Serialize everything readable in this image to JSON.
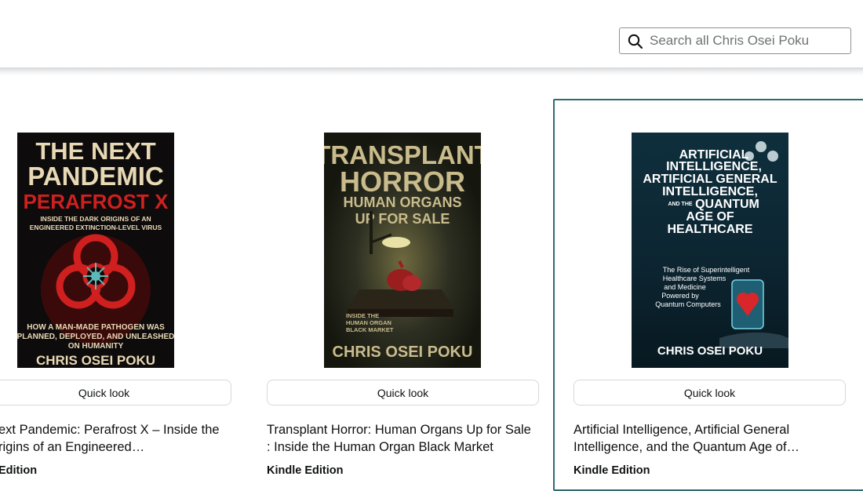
{
  "search": {
    "placeholder": "Search all Chris Osei Poku"
  },
  "books": [
    {
      "cover": {
        "title_line1": "THE NEXT",
        "title_line2": "PANDEMIC",
        "subtitle": "PERAFROST X",
        "tagline1": "INSIDE THE DARK ORIGINS OF AN",
        "tagline2": "ENGINEERED EXTINCTION-LEVEL VIRUS",
        "blurb1": "HOW A MAN-MADE PATHOGEN WAS",
        "blurb2": "PLANNED, DEPLOYED, AND UNLEASHED",
        "blurb3": "ON HUMANITY",
        "author": "CHRIS OSEI POKU"
      },
      "quick_look": "Quick look",
      "title": "ext Pandemic: Perafrost X – Inside the\nrigins of an Engineered…",
      "format": "Edition"
    },
    {
      "cover": {
        "title_line1": "TRANSPLANT",
        "title_line2": "HORROR",
        "subtitle1": "HUMAN ORGANS",
        "subtitle2": "UP FOR SALE",
        "tagline1": "INSIDE THE",
        "tagline2": "HUMAN ORGAN",
        "tagline3": "BLACK MARKET",
        "author": "CHRIS OSEI POKU"
      },
      "quick_look": "Quick look",
      "title": "Transplant Horror: Human Organs Up for Sale\n: Inside the Human Organ Black Market",
      "format": "Kindle Edition"
    },
    {
      "cover": {
        "line1": "ARTIFICIAL",
        "line2": "INTELLIGENCE,",
        "line3": "ARTIFICIAL GENERAL",
        "line4": "INTELLIGENCE,",
        "line5_prefix": "AND THE",
        "line5": "QUANTUM",
        "line6": "AGE OF",
        "line7": "HEALTHCARE",
        "sub1": "The Rise of Superintelligent",
        "sub2": "Healthcare Systems",
        "sub3": "and Medicine",
        "sub4": "Powered by",
        "sub5": "Quantum Computers",
        "author": "CHRIS OSEI POKU"
      },
      "quick_look": "Quick look",
      "title": "Artificial Intelligence, Artificial General\nIntelligence, and the Quantum Age of…",
      "format": "Kindle Edition"
    }
  ]
}
